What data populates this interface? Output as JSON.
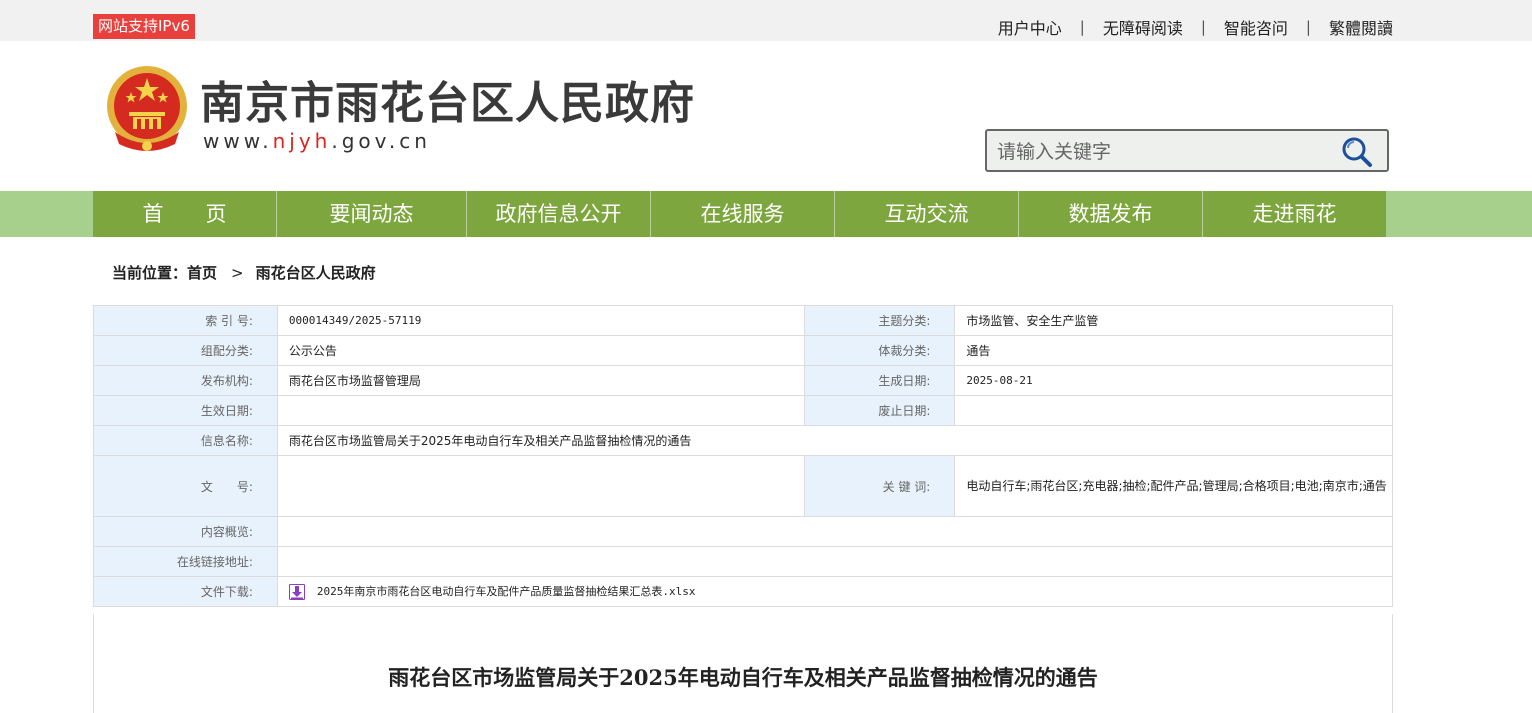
{
  "topbar": {
    "ipv6_badge": "网站支持IPv6",
    "links": [
      "用户中心",
      "无障碍阅读",
      "智能咨问",
      "繁體閱讀"
    ],
    "badge_color": "#e8403c"
  },
  "header": {
    "site_title": "南京市雨花台区人民政府",
    "url_prefix": "www.",
    "url_highlight": "njyh",
    "url_suffix": ".gov.cn",
    "emblem_icon": "national-emblem-icon"
  },
  "search": {
    "placeholder": "请输入关键字",
    "icon": "search-icon"
  },
  "nav": {
    "items": [
      "首　　页",
      "要闻动态",
      "政府信息公开",
      "在线服务",
      "互动交流",
      "数据发布",
      "走进雨花"
    ],
    "color": "#7ea63e"
  },
  "breadcrumb": {
    "prefix": "当前位置：",
    "home": "首页",
    "arrow": ">",
    "current": "雨花台区人民政府"
  },
  "meta": {
    "index_label": "索 引 号:",
    "index_value": "000014349/2025-57119",
    "topic_label": "主题分类:",
    "topic_value": "市场监管、安全生产监管",
    "group_label": "组配分类:",
    "group_value": "公示公告",
    "genre_label": "体裁分类:",
    "genre_value": "通告",
    "org_label": "发布机构:",
    "org_value": "雨花台区市场监督管理局",
    "created_label": "生成日期:",
    "created_value": "2025-08-21",
    "effective_label": "生效日期:",
    "effective_value": "",
    "expire_label": "废止日期:",
    "expire_value": "",
    "name_label": "信息名称:",
    "name_value": "雨花台区市场监管局关于2025年电动自行车及相关产品监督抽检情况的通告",
    "docno_label": "文　　号:",
    "docno_value": "",
    "keywords_label": "关 键 词:",
    "keywords_value": "电动自行车;雨花台区;充电器;抽检;配件产品;管理局;合格项目;电池;南京市;通告",
    "summary_label": "内容概览:",
    "summary_value": "",
    "link_label": "在线链接地址:",
    "link_value": "",
    "download_label": "文件下载:",
    "download_file": "2025年南京市雨花台区电动自行车及配件产品质量监督抽检结果汇总表.xlsx",
    "download_icon": "download-icon"
  },
  "article": {
    "title": "雨花台区市场监管局关于2025年电动自行车及相关产品监督抽检情况的通告"
  }
}
